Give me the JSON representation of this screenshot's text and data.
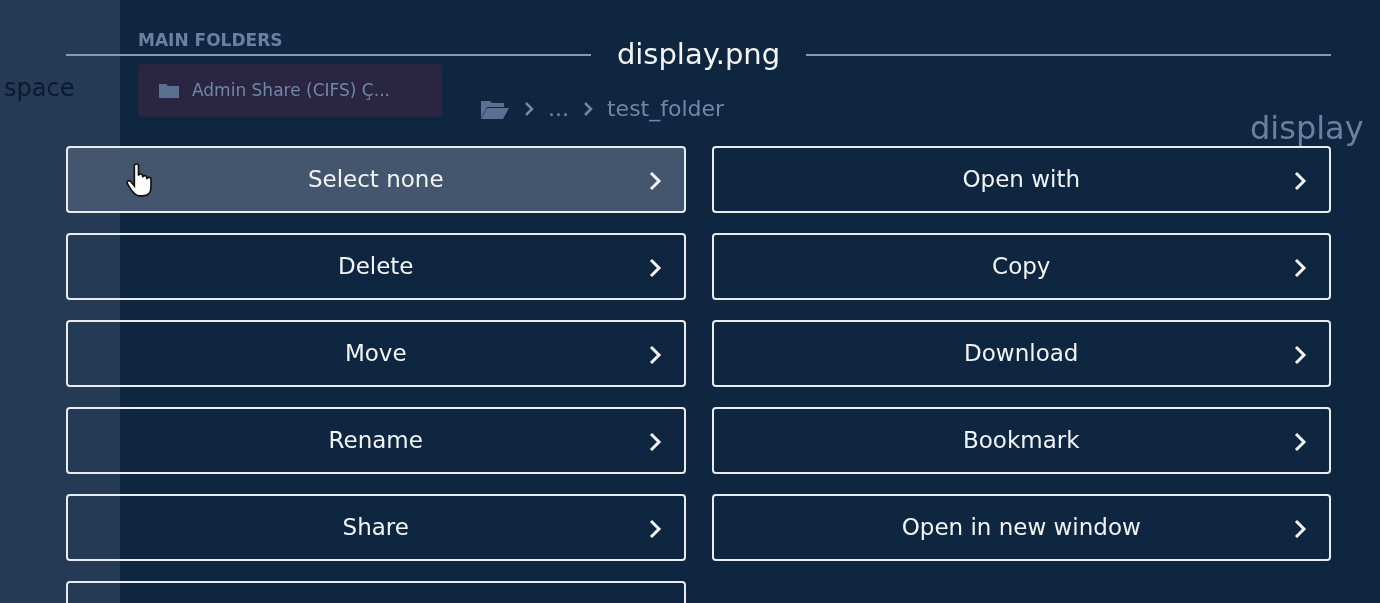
{
  "background": {
    "workspace_label": "space",
    "sidebar_heading": "MAIN FOLDERS",
    "sidebar_items": [
      {
        "label": "Admin Share (CIFS) Ç...",
        "selected": true
      }
    ],
    "breadcrumb": [
      "...",
      "test_folder"
    ],
    "details_title": "display"
  },
  "dialog": {
    "title": "display.png",
    "actions": [
      {
        "label": "Select none",
        "highlighted": true
      },
      {
        "label": "Open with",
        "highlighted": false
      },
      {
        "label": "Delete",
        "highlighted": false
      },
      {
        "label": "Copy",
        "highlighted": false
      },
      {
        "label": "Move",
        "highlighted": false
      },
      {
        "label": "Download",
        "highlighted": false
      },
      {
        "label": "Rename",
        "highlighted": false
      },
      {
        "label": "Bookmark",
        "highlighted": false
      },
      {
        "label": "Share",
        "highlighted": false
      },
      {
        "label": "Open in new window",
        "highlighted": false
      }
    ]
  }
}
